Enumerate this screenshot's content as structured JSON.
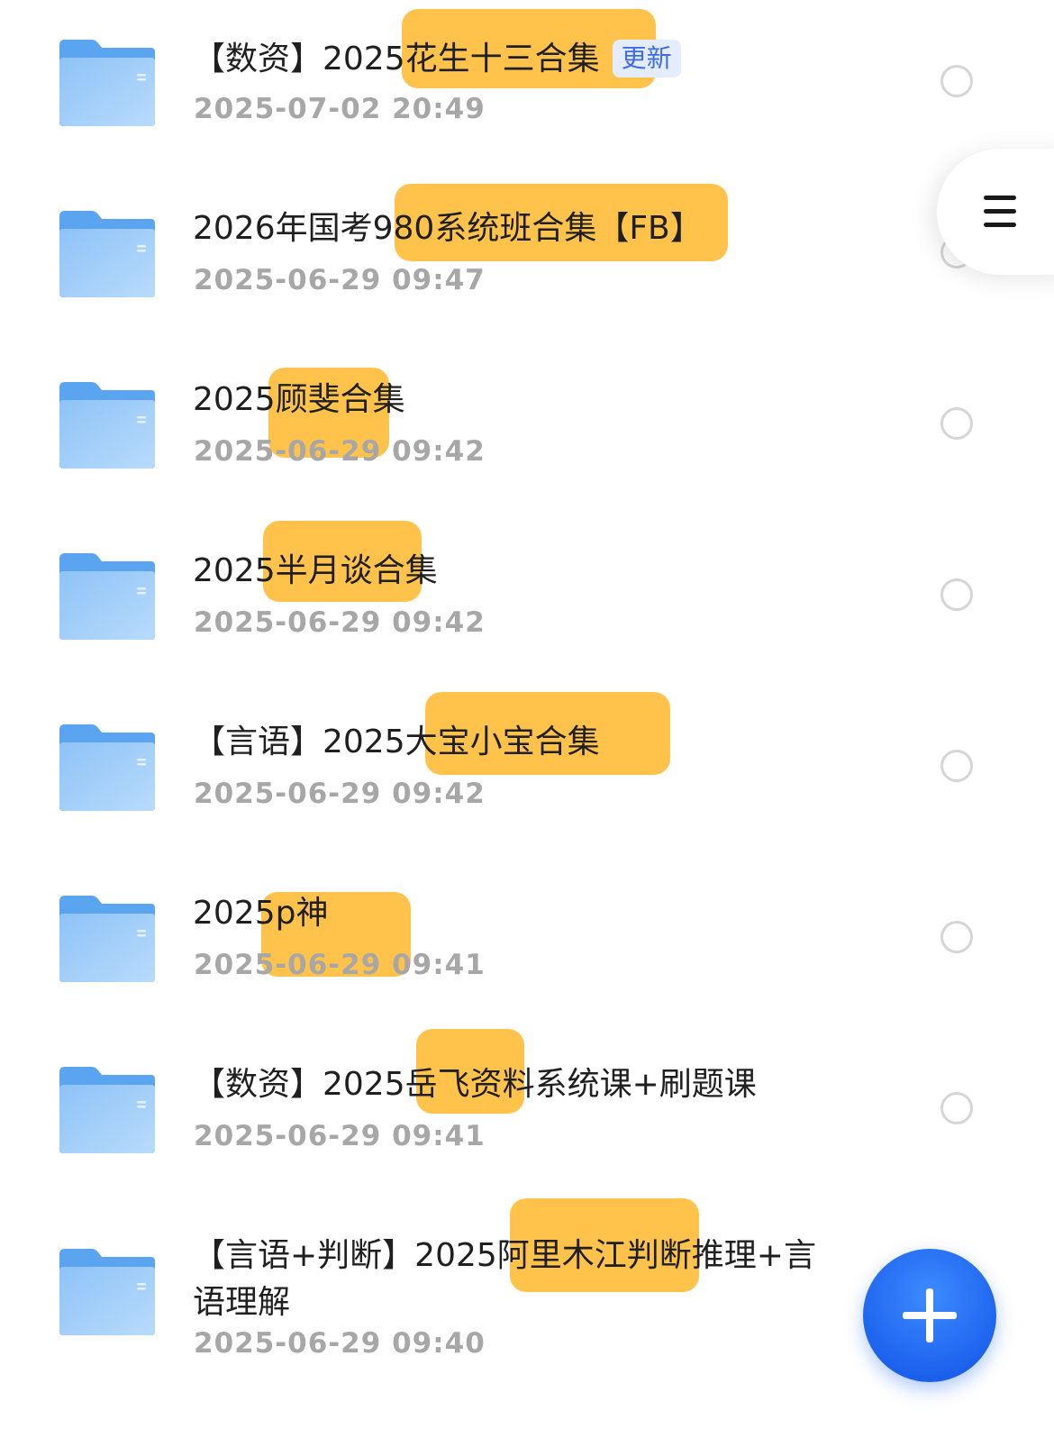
{
  "files": [
    {
      "name": "【数资】2025花生十三合集",
      "tag": "更新",
      "date": "2025-07-02 20:49"
    },
    {
      "name": "2026年国考980系统班合集【FB】",
      "date": "2025-06-29 09:47"
    },
    {
      "name": "2025顾斐合集",
      "date": "2025-06-29 09:42"
    },
    {
      "name": "2025半月谈合集",
      "date": "2025-06-29 09:42"
    },
    {
      "name": "【言语】2025大宝小宝合集",
      "date": "2025-06-29 09:42"
    },
    {
      "name": "2025p神",
      "date": "2025-06-29 09:41"
    },
    {
      "name": "【数资】2025岳飞资料系统课+刷题课",
      "date": "2025-06-29 09:41"
    },
    {
      "name": "【言语+判断】2025阿里木江判断推理+言语理解",
      "date": "2025-06-29 09:40"
    }
  ],
  "icons": {
    "folder": "folder-icon",
    "select": "radio-circle-icon",
    "menu": "hamburger-menu-icon",
    "add": "plus-icon"
  },
  "colors": {
    "highlight": "#ffbb33",
    "folder": "#7fb8f5",
    "fab": "#1d63ee",
    "date": "#a7a7a7",
    "tag_bg": "#e4ecff",
    "tag_text": "#3f6ae8"
  }
}
